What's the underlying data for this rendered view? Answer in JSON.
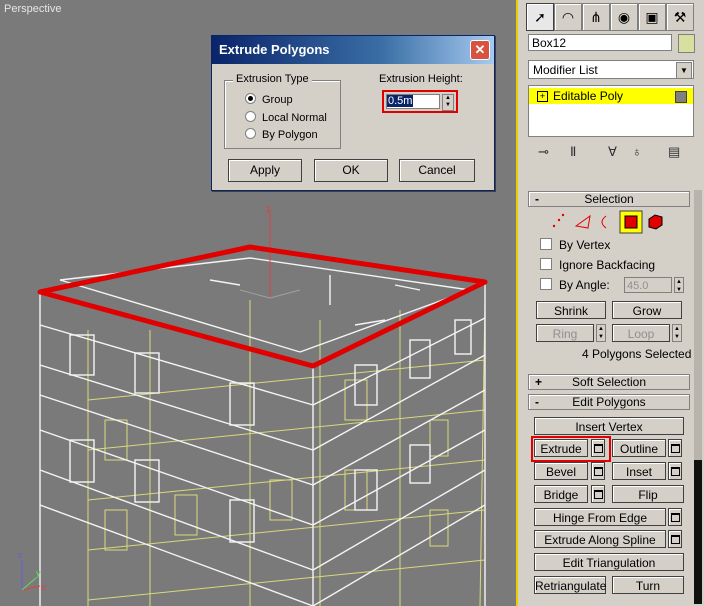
{
  "viewport": {
    "label": "Perspective",
    "axis_z": "z",
    "axis_x": "x",
    "axis_y": "y"
  },
  "dialog": {
    "title": "Extrude Polygons",
    "close": "✕",
    "group_title": "Extrusion Type",
    "options": [
      {
        "label": "Group",
        "selected": true
      },
      {
        "label": "Local Normal",
        "selected": false
      },
      {
        "label": "By Polygon",
        "selected": false
      }
    ],
    "height_label": "Extrusion Height:",
    "height_value": "0.5m",
    "buttons": {
      "apply": "Apply",
      "ok": "OK",
      "cancel": "Cancel"
    }
  },
  "panel": {
    "tabs": [
      "create-icon",
      "modify-icon",
      "hierarchy-icon",
      "motion-icon",
      "display-icon",
      "utilities-icon"
    ],
    "object_name": "Box12",
    "modifier_list": "Modifier List",
    "stack_item": "Editable Poly",
    "selection": {
      "title": "Selection",
      "by_vertex": "By Vertex",
      "ignore_backfacing": "Ignore Backfacing",
      "by_angle": "By Angle:",
      "angle_value": "45.0",
      "shrink": "Shrink",
      "grow": "Grow",
      "ring": "Ring",
      "loop": "Loop",
      "status": "4 Polygons Selected"
    },
    "soft_selection": "Soft Selection",
    "edit_polygons": {
      "title": "Edit Polygons",
      "insert_vertex": "Insert Vertex",
      "extrude": "Extrude",
      "outline": "Outline",
      "bevel": "Bevel",
      "inset": "Inset",
      "bridge": "Bridge",
      "flip": "Flip",
      "hinge": "Hinge From Edge",
      "extrude_spline": "Extrude Along Spline",
      "edit_triangulation": "Edit Triangulation",
      "retriangulate": "Retriangulate",
      "turn": "Turn"
    },
    "minus": "-",
    "plus": "+"
  }
}
